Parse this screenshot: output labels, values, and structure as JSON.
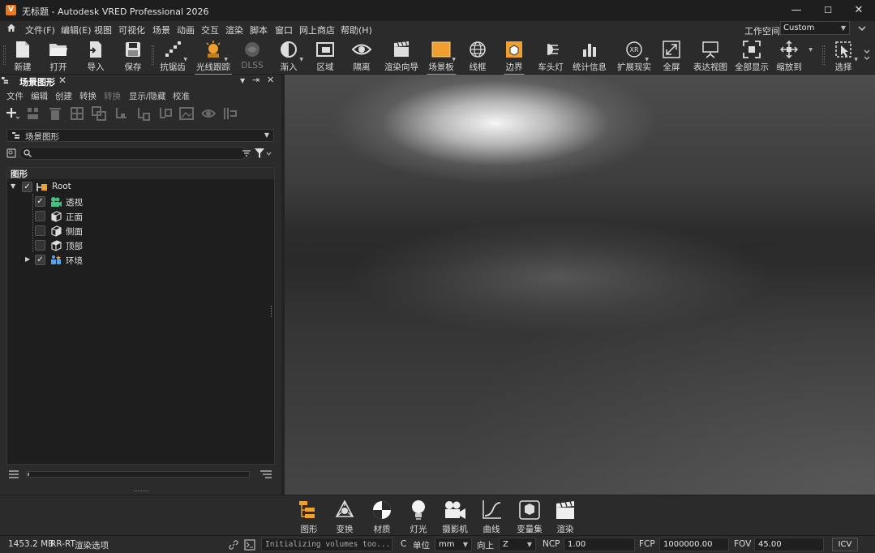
{
  "window": {
    "title": "无标题 - Autodesk VRED Professional 2026",
    "logo_letter": "V",
    "minimize": "—",
    "maximize": "☐",
    "close": "✕"
  },
  "menubar": {
    "items": [
      "文件(F)",
      "编辑(E)",
      "视图",
      "可视化",
      "场景",
      "动画",
      "交互",
      "渲染",
      "脚本",
      "窗口",
      "网上商店",
      "帮助(H)"
    ],
    "workspace_label": "工作空间",
    "workspace_value": "Custom"
  },
  "toolbar": {
    "buttons": [
      {
        "label": "新建",
        "icon": "new-file-icon"
      },
      {
        "label": "打开",
        "icon": "open-folder-icon"
      },
      {
        "label": "导入",
        "icon": "import-icon"
      },
      {
        "label": "保存",
        "icon": "save-icon"
      },
      {
        "label": "抗锯齿",
        "icon": "antialias-icon"
      },
      {
        "label": "光线跟踪",
        "icon": "raytracing-icon"
      },
      {
        "label": "DLSS",
        "icon": "dlss-icon"
      },
      {
        "label": "渐入",
        "icon": "fade-in-icon"
      },
      {
        "label": "区域",
        "icon": "region-icon"
      },
      {
        "label": "隔离",
        "icon": "isolate-icon"
      },
      {
        "label": "渲染向导",
        "icon": "render-wizard-icon"
      },
      {
        "label": "场景板",
        "icon": "sceneplate-icon"
      },
      {
        "label": "线框",
        "icon": "wireframe-icon"
      },
      {
        "label": "边界",
        "icon": "bounds-icon"
      },
      {
        "label": "车头灯",
        "icon": "headlight-icon"
      },
      {
        "label": "统计信息",
        "icon": "statistics-icon"
      },
      {
        "label": "扩展现实",
        "icon": "xr-icon"
      },
      {
        "label": "全屏",
        "icon": "fullscreen-icon"
      },
      {
        "label": "表达视图",
        "icon": "presentation-icon"
      },
      {
        "label": "全部显示",
        "icon": "show-all-icon"
      },
      {
        "label": "缩放到",
        "icon": "zoom-to-icon"
      },
      {
        "label": "选择",
        "icon": "select-icon"
      }
    ]
  },
  "scenegraph": {
    "tab_title": "场景图形",
    "tab_close": "✕",
    "menu": [
      "文件",
      "编辑",
      "创建",
      "转换",
      "转换",
      "显示/隐藏",
      "校准"
    ],
    "graph_select": "场景图形",
    "search_placeholder": "",
    "tree_header": "图形",
    "nodes": [
      {
        "label": "Root",
        "checked": true
      },
      {
        "label": "透视",
        "checked": true
      },
      {
        "label": "正面",
        "checked": false
      },
      {
        "label": "侧面",
        "checked": false
      },
      {
        "label": "顶部",
        "checked": false
      },
      {
        "label": "环境",
        "checked": true
      }
    ]
  },
  "bottom_dock": {
    "buttons": [
      {
        "label": "图形",
        "icon": "graph-icon"
      },
      {
        "label": "变换",
        "icon": "transform-icon"
      },
      {
        "label": "材质",
        "icon": "material-icon"
      },
      {
        "label": "灯光",
        "icon": "light-icon"
      },
      {
        "label": "摄影机",
        "icon": "camera-icon"
      },
      {
        "label": "曲线",
        "icon": "curve-icon"
      },
      {
        "label": "变量集",
        "icon": "variant-sets-icon"
      },
      {
        "label": "渲染",
        "icon": "render-icon"
      }
    ]
  },
  "statusbar": {
    "memory": "1453.2 MB",
    "render_mode": "RR-RT",
    "render_options": "渲染选项",
    "log": "Initializing volumes too...",
    "c": "C",
    "unit_label": "单位",
    "unit_value": "mm",
    "up_label": "向上",
    "up_value": "Z",
    "ncp_label": "NCP",
    "ncp_value": "1.00",
    "fcp_label": "FCP",
    "fcp_value": "1000000.00",
    "fov_label": "FOV",
    "fov_value": "45.00",
    "icv": "ICV"
  },
  "colors": {
    "accent_orange": "#f0a030",
    "accent_blue": "#59a4e8",
    "bg": "#2b2b2b"
  }
}
